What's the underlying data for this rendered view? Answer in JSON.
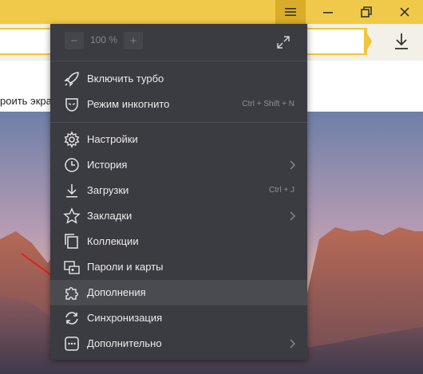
{
  "window": {
    "menu_icon": "hamburger-menu-icon",
    "minimize_icon": "minimize-icon",
    "maximize_icon": "restore-icon",
    "close_icon": "close-icon",
    "download_icon": "download-icon"
  },
  "page": {
    "partial_text": "роить экра"
  },
  "menu": {
    "zoom": {
      "minus_label": "−",
      "value": "100 %",
      "plus_label": "+",
      "fullscreen_icon": "fullscreen-icon"
    },
    "items": [
      {
        "id": "turbo",
        "label": "Включить турбо",
        "icon": "rocket-icon",
        "hotkey": "",
        "submenu": false
      },
      {
        "id": "incognito",
        "label": "Режим инкогнито",
        "icon": "incognito-mask-icon",
        "hotkey": "Ctrl + Shift + N",
        "submenu": false
      },
      {
        "id": "settings",
        "label": "Настройки",
        "icon": "gear-icon",
        "hotkey": "",
        "submenu": false
      },
      {
        "id": "history",
        "label": "История",
        "icon": "clock-icon",
        "hotkey": "",
        "submenu": true
      },
      {
        "id": "downloads",
        "label": "Загрузки",
        "icon": "download-icon",
        "hotkey": "Ctrl + J",
        "submenu": false
      },
      {
        "id": "bookmarks",
        "label": "Закладки",
        "icon": "star-icon",
        "hotkey": "",
        "submenu": true
      },
      {
        "id": "collections",
        "label": "Коллекции",
        "icon": "collections-icon",
        "hotkey": "",
        "submenu": false
      },
      {
        "id": "passwords",
        "label": "Пароли и карты",
        "icon": "key-card-icon",
        "hotkey": "",
        "submenu": false
      },
      {
        "id": "extensions",
        "label": "Дополнения",
        "icon": "puzzle-icon",
        "hotkey": "",
        "submenu": false
      },
      {
        "id": "sync",
        "label": "Синхронизация",
        "icon": "sync-icon",
        "hotkey": "",
        "submenu": false
      },
      {
        "id": "more",
        "label": "Дополнительно",
        "icon": "more-dots-icon",
        "hotkey": "",
        "submenu": true
      }
    ],
    "active_item": "extensions"
  },
  "colors": {
    "toolbar": "#f1c94a",
    "menu_bg": "#3b3b42",
    "menu_hover": "#4a4a51",
    "menu_text": "#ececec",
    "annotation_arrow": "#e02020"
  }
}
